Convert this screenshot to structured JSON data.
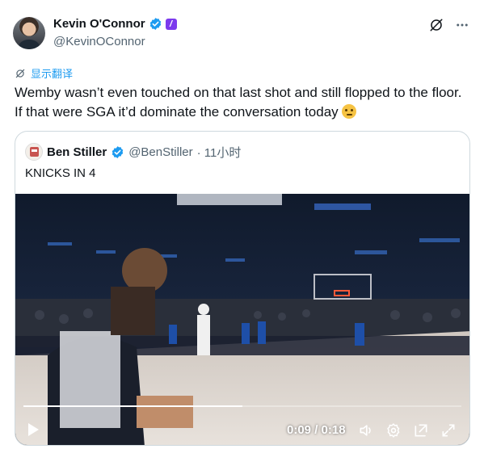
{
  "author": {
    "display_name": "Kevin O'Connor",
    "handle": "@KevinOConnor",
    "verified_icon": "verified-badge-icon",
    "affiliate_icon": "affiliate-badge-icon",
    "affiliate_letter": "/"
  },
  "actions": {
    "grok_icon": "grok-icon",
    "more_icon": "more-options-icon"
  },
  "translate": {
    "label": "显示翻译",
    "icon": "translate-icon"
  },
  "tweet": {
    "text": "Wemby wasn’t even touched on that last shot and still flopped to the floor. If that were SGA it’d dominate the conversation today",
    "emoji": "thinking-face-emoji"
  },
  "quote": {
    "display_name": "Ben Stiller",
    "handle": "@BenStiller",
    "time": "· 11小时",
    "text": "KNICKS IN 4"
  },
  "video": {
    "time_label": "0:09 / 0:18",
    "progress": 0.5,
    "controls": [
      "play-icon",
      "volume-icon",
      "settings-icon",
      "pop-out-icon",
      "fullscreen-icon"
    ]
  },
  "colors": {
    "accent": "#1d9bf0",
    "text": "#0f1419",
    "muted": "#536471",
    "border": "#cfd9de",
    "affiliate": "#7c3aed"
  }
}
